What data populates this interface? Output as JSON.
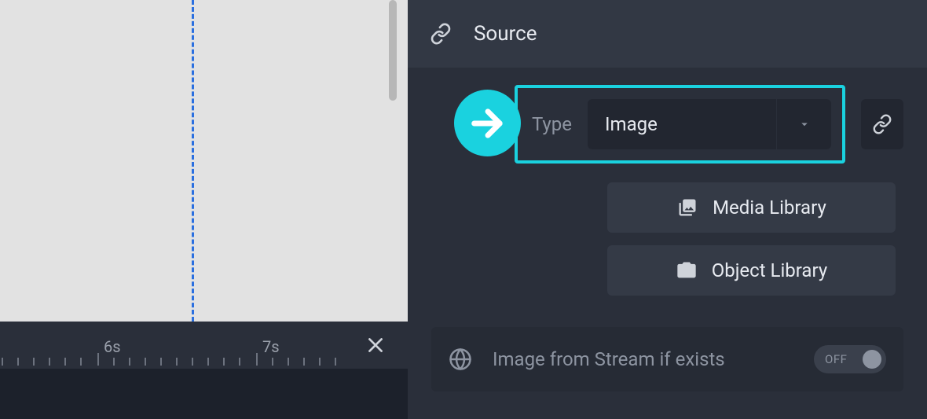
{
  "timeline": {
    "markers": [
      "6s",
      "7s"
    ]
  },
  "panel": {
    "section_title": "Source",
    "type_label": "Type",
    "type_value": "Image",
    "media_library_label": "Media Library",
    "object_library_label": "Object Library",
    "stream_label": "Image from Stream if exists",
    "stream_toggle": "OFF"
  }
}
